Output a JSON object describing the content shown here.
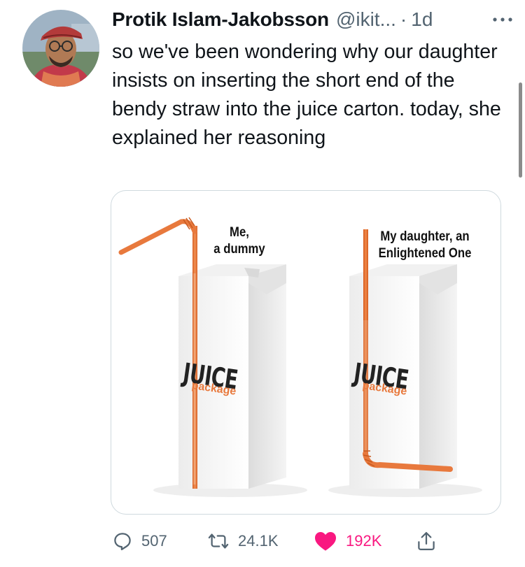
{
  "tweet": {
    "author_name": "Protik Islam-Jakobsson",
    "handle": "@ikit...",
    "separator": "·",
    "time": "1d",
    "text": "so we've been wondering why our daughter insists on inserting the short end of the bendy straw into the juice carton. today, she explained her reasoning"
  },
  "media": {
    "left_caption_line1": "Me,",
    "left_caption_line2": "a dummy",
    "right_caption_line1": "My daughter, an",
    "right_caption_line2": "Enlightened One",
    "brand": "JUICE",
    "brand_sub": "package"
  },
  "actions": {
    "replies": "507",
    "retweets": "24.1K",
    "likes": "192K"
  },
  "colors": {
    "like_active": "#f91880",
    "muted": "#536471",
    "straw": "#e8793d"
  },
  "icons": [
    "more-icon",
    "reply-icon",
    "retweet-icon",
    "like-icon",
    "share-icon"
  ]
}
